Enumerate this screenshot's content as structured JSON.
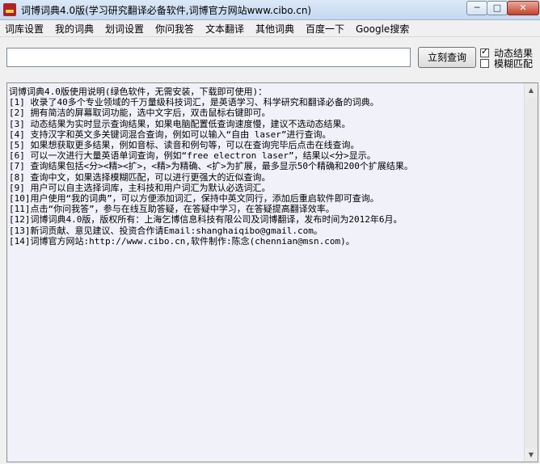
{
  "window": {
    "title": "词博词典4.0版(学习研究翻译必备软件,词博官方网站www.cibo.cn)",
    "minimize_label": "─",
    "maximize_label": "□",
    "close_label": "✕"
  },
  "menu": {
    "items": [
      "词库设置",
      "我的词典",
      "划词设置",
      "你问我答",
      "文本翻译",
      "其他词典",
      "百度一下",
      "Google搜索"
    ]
  },
  "search": {
    "value": "",
    "placeholder": "",
    "button_label": "立刻查询"
  },
  "options": {
    "dynamic_results": {
      "label": "动态结果",
      "checked": true,
      "mark": "✓"
    },
    "fuzzy_match": {
      "label": "模糊匹配",
      "checked": false,
      "mark": ""
    }
  },
  "content": {
    "lines": [
      "词博词典4.0版使用说明(绿色软件，无需安装，下载即可使用)：",
      "",
      "[1] 收录了40多个专业领域的千万量级科技词汇，是英语学习、科学研究和翻译必备的词典。",
      "[2] 拥有简洁的屏幕取词功能，选中文字后，双击鼠标右键即可。",
      "[3] 动态结果为实时显示查询结果，如果电脑配置低查询速度慢，建议不选动态结果。",
      "[4] 支持汉字和英文多关键词混合查询，例如可以输入“自由 laser”进行查询。",
      "[5] 如果想获取更多结果，例如音标、读音和例句等，可以在查询完毕后点击在线查询。",
      "[6] 可以一次进行大量英语单词查询，例如“free electron laser”，结果以<分>显示。",
      "[7] 查询结果包括<分><精><扩>，<精>为精确、<扩>为扩展，最多显示50个精确和200个扩展结果。",
      "[8] 查询中文，如果选择模糊匹配，可以进行更强大的近似查询。",
      "[9] 用户可以自主选择词库，主科技和用户词汇为默认必选词汇。",
      "[10]用户使用“我的词典”，可以方便添加词汇，保持中英文同行，添加后重启软件即可查询。",
      "[11]点击“你问我答”，参与在线互助答疑，在答疑中学习，在答疑提高翻译效率。",
      "[12]词博词典4.0版，版权所有：上海乞博信息科技有限公司及词博翻译，发布时间为2012年6月。",
      "[13]新词贡献、意见建议、投资合作请Email:shanghaiqibo@gmail.com。",
      "[14]词博官方网站:http://www.cibo.cn,软件制作:陈念(chennian@msn.com)。"
    ]
  },
  "scrollbar": {
    "up_arrow": "▲",
    "down_arrow": "▼"
  }
}
